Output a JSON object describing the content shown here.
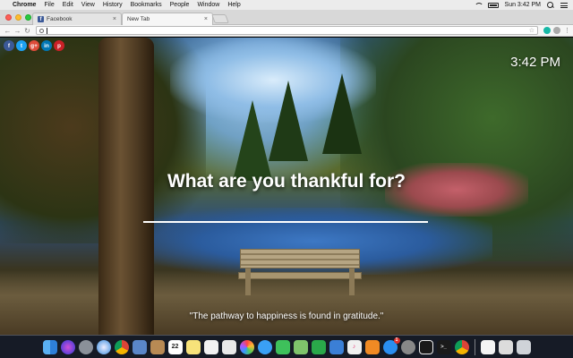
{
  "menubar": {
    "apple_glyph": "",
    "items": [
      "Chrome",
      "File",
      "Edit",
      "View",
      "History",
      "Bookmarks",
      "People",
      "Window",
      "Help"
    ],
    "clock": "Sun 3:42 PM"
  },
  "tabs": [
    {
      "label": "Facebook",
      "close": "×",
      "favicon": "f"
    },
    {
      "label": "New Tab",
      "close": "×"
    }
  ],
  "toolbar": {
    "back": "←",
    "forward": "→",
    "reload": "↻",
    "omnibox_value": "",
    "star": "☆",
    "menu": "⋮"
  },
  "social": [
    {
      "icon": "facebook-icon",
      "glyph": "f",
      "color": "#3b5998"
    },
    {
      "icon": "twitter-icon",
      "glyph": "t",
      "color": "#1da1f2"
    },
    {
      "icon": "google-plus-icon",
      "glyph": "g+",
      "color": "#dd4b39"
    },
    {
      "icon": "linkedin-icon",
      "glyph": "in",
      "color": "#0077b5"
    },
    {
      "icon": "pinterest-icon",
      "glyph": "p",
      "color": "#cb2027"
    }
  ],
  "page": {
    "clock": "3:42 PM",
    "prompt": "What are you thankful for?",
    "answer_value": "",
    "quote": "\"The pathway to happiness is found in gratitude.\""
  },
  "dock": {
    "calendar_day": "22",
    "notification_badge": "1",
    "icons": [
      "finder-icon",
      "siri-icon",
      "launchpad-icon",
      "safari-icon",
      "chrome-icon",
      "preview-icon",
      "contacts-icon",
      "calendar-icon",
      "notes-icon",
      "reminders-icon",
      "stickies-icon",
      "photos-icon",
      "messages-icon",
      "facetime-icon",
      "maps-icon",
      "numbers-icon",
      "keynote-icon",
      "itunes-icon",
      "ibooks-icon",
      "app-store-icon",
      "system-preferences-icon",
      "crash-plan-icon",
      "terminal-icon",
      "chrome-icon",
      "document-icon",
      "downloads-icon",
      "trash-icon"
    ]
  }
}
